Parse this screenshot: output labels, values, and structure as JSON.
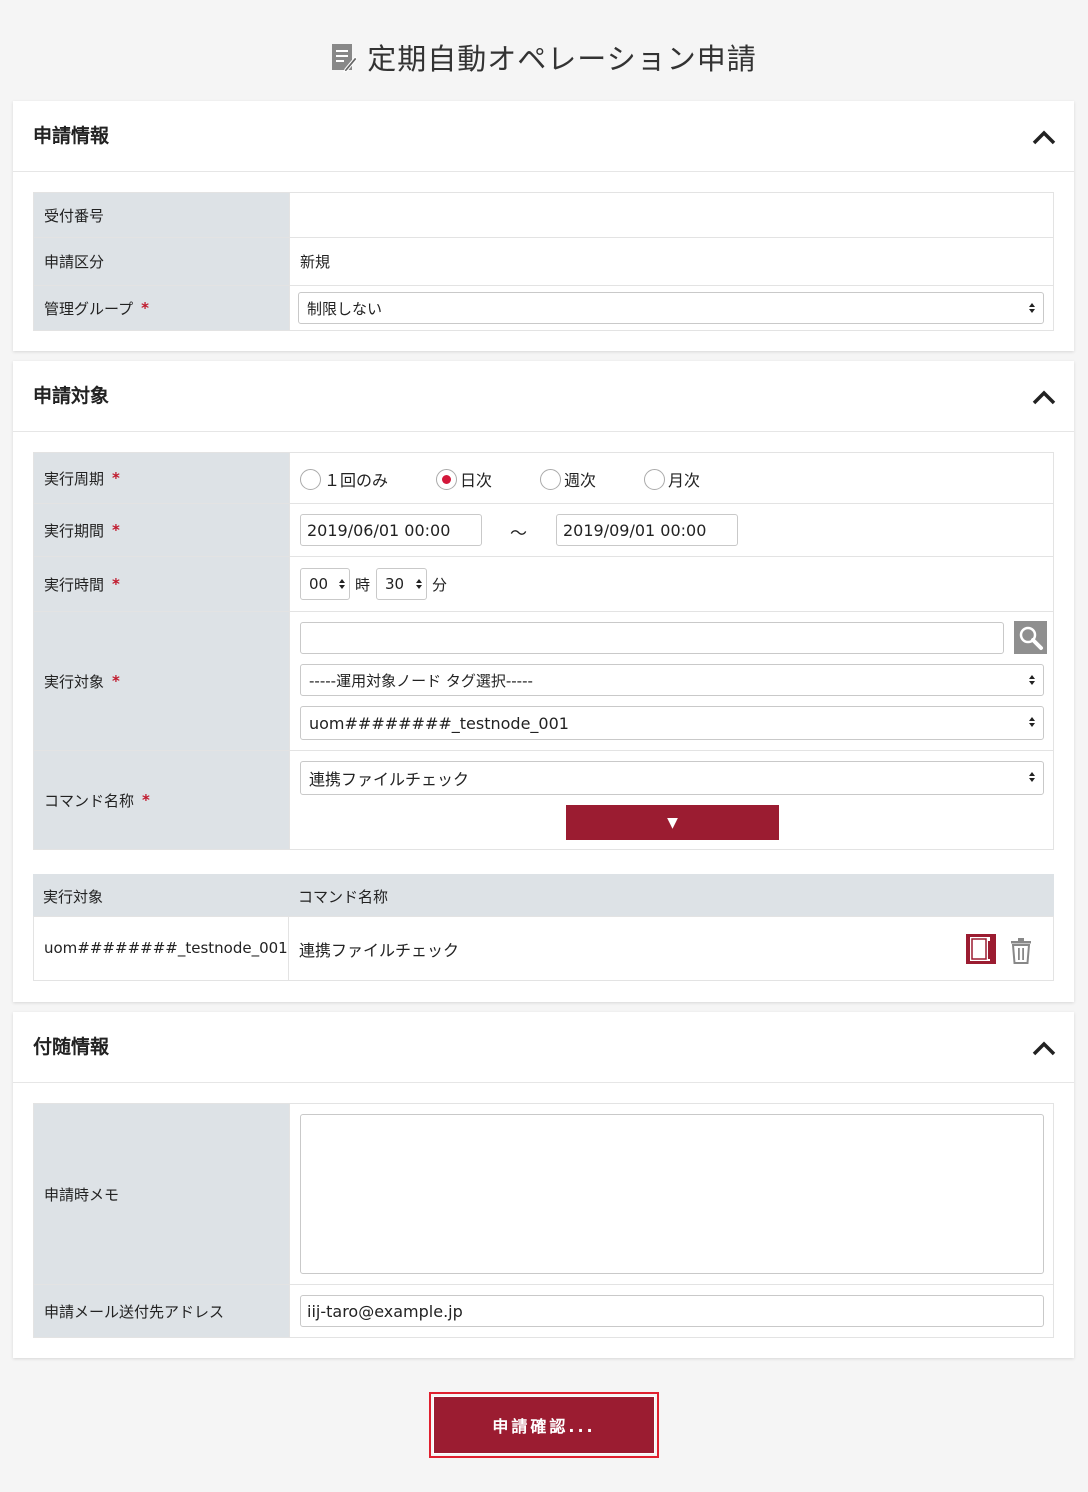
{
  "page": {
    "title": "定期自動オペレーション申請"
  },
  "sections": {
    "application_info": {
      "title": "申請情報",
      "rows": {
        "receipt_number": {
          "label": "受付番号",
          "value": ""
        },
        "application_type": {
          "label": "申請区分",
          "value": "新規"
        },
        "management_group": {
          "label": "管理グループ",
          "required_mark": "*",
          "selected": "制限しない"
        }
      }
    },
    "application_target": {
      "title": "申請対象",
      "schedule": {
        "label": "実行周期",
        "required_mark": "*",
        "options": [
          "１回のみ",
          "日次",
          "週次",
          "月次"
        ],
        "selected": "日次"
      },
      "period": {
        "label": "実行期間",
        "required_mark": "*",
        "start": "2019/06/01 00:00",
        "separator": "～",
        "end": "2019/09/01 00:00"
      },
      "time": {
        "label": "実行時間",
        "required_mark": "*",
        "hour": "00",
        "hour_unit": "時",
        "minute": "30",
        "minute_unit": "分"
      },
      "target": {
        "label": "実行対象",
        "required_mark": "*",
        "search_value": "",
        "tag_select": "-----運用対象ノード タグ選択-----",
        "node_select": "uom########_testnode_001"
      },
      "command": {
        "label": "コマンド名称",
        "required_mark": "*",
        "selected": "連携ファイルチェック",
        "add_button": "▼"
      },
      "list": {
        "headers": [
          "実行対象",
          "コマンド名称"
        ],
        "rows": [
          {
            "target": "uom########_testnode_001",
            "command": "連携ファイルチェック"
          }
        ]
      }
    },
    "additional_info": {
      "title": "付随情報",
      "memo": {
        "label": "申請時メモ",
        "value": ""
      },
      "email": {
        "label": "申請メール送付先アドレス",
        "value": "iij-taro@example.jp"
      }
    }
  },
  "submit": {
    "label": "申請確認..."
  },
  "colors": {
    "accent": "#9b1c31",
    "required": "#c0192c",
    "label_bg": "#dde2e6",
    "radio_on": "#d3173a"
  }
}
